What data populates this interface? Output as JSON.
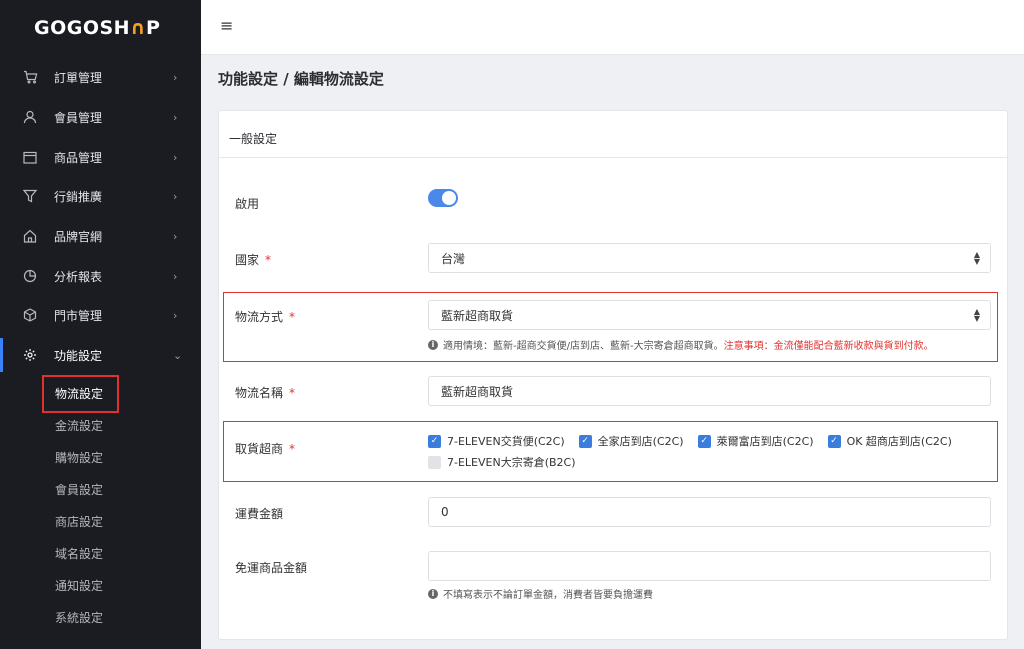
{
  "brand": {
    "logo_a": "GOGOSH",
    "logo_b": "∩",
    "logo_c": "P",
    "accent": "#f4a21b"
  },
  "sidebar": {
    "items": [
      {
        "label": "訂單管理",
        "icon": "cart-icon"
      },
      {
        "label": "會員管理",
        "icon": "user-icon"
      },
      {
        "label": "商品管理",
        "icon": "calendar-icon"
      },
      {
        "label": "行銷推廣",
        "icon": "funnel-icon"
      },
      {
        "label": "品牌官網",
        "icon": "home-icon"
      },
      {
        "label": "分析報表",
        "icon": "pie-chart-icon"
      },
      {
        "label": "門市管理",
        "icon": "box-icon"
      },
      {
        "label": "功能設定",
        "icon": "gear-icon"
      }
    ],
    "sub_items": [
      "物流設定",
      "金流設定",
      "購物設定",
      "會員設定",
      "商店設定",
      "域名設定",
      "通知設定",
      "系統設定"
    ]
  },
  "page": {
    "title": "功能設定 / 編輯物流設定"
  },
  "card": {
    "header": "一般設定"
  },
  "form": {
    "enable_label": "啟用",
    "country_label": "國家",
    "country_value": "台灣",
    "method_label": "物流方式",
    "method_value": "藍新超商取貨",
    "method_help": "適用情境：藍新-超商交貨便/店到店、藍新-大宗寄倉超商取貨。",
    "method_warn": "注意事項：金流僅能配合藍新收款與貨到付款。",
    "name_label": "物流名稱",
    "name_value": "藍新超商取貨",
    "pickup_label": "取貨超商",
    "pickup_options": [
      {
        "label": "7-ELEVEN交貨便(C2C)",
        "checked": true
      },
      {
        "label": "全家店到店(C2C)",
        "checked": true
      },
      {
        "label": "萊爾富店到店(C2C)",
        "checked": true
      },
      {
        "label": "OK 超商店到店(C2C)",
        "checked": true
      },
      {
        "label": "7-ELEVEN大宗寄倉(B2C)",
        "checked": false
      }
    ],
    "fee_label": "運費金額",
    "fee_value": "0",
    "free_label": "免運商品金額",
    "free_value": "",
    "free_help": "不填寫表示不論訂單金額，消費者皆要負擔運費"
  }
}
